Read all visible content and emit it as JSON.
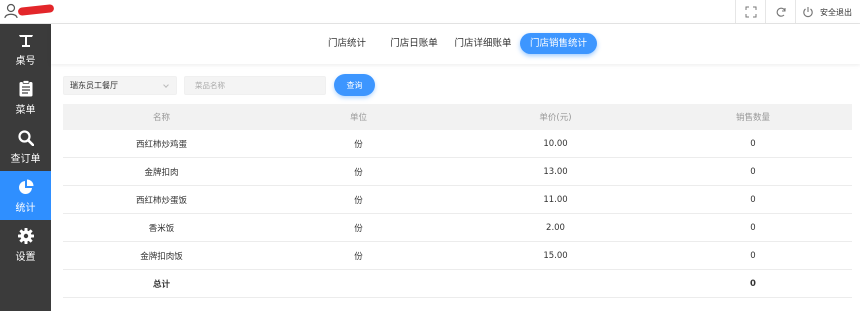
{
  "header": {
    "logout_label": "安全退出",
    "icons": [
      "user-icon",
      "fullscreen-icon",
      "refresh-icon",
      "power-icon"
    ]
  },
  "sidebar": {
    "items": [
      {
        "label": "桌号",
        "icon": "table-icon",
        "active": false
      },
      {
        "label": "菜单",
        "icon": "clipboard-icon",
        "active": false
      },
      {
        "label": "查订单",
        "icon": "search-icon",
        "active": false
      },
      {
        "label": "统计",
        "icon": "pie-chart-icon",
        "active": true
      },
      {
        "label": "设置",
        "icon": "gear-icon",
        "active": false
      }
    ]
  },
  "tabs": [
    {
      "label": "门店统计",
      "active": false
    },
    {
      "label": "门店日账单",
      "active": false
    },
    {
      "label": "门店详细账单",
      "active": false
    },
    {
      "label": "门店销售统计",
      "active": true
    }
  ],
  "filters": {
    "store_value": "瑞东员工餐厅",
    "dish_placeholder": "菜品名称",
    "query_label": "查询"
  },
  "table": {
    "columns": [
      "名称",
      "单位",
      "单价(元)",
      "销售数量"
    ],
    "rows": [
      [
        "西红柿炒鸡蛋",
        "份",
        "10.00",
        "0"
      ],
      [
        "金牌扣肉",
        "份",
        "13.00",
        "0"
      ],
      [
        "西红柿炒蛋饭",
        "份",
        "11.00",
        "0"
      ],
      [
        "香米饭",
        "份",
        "2.00",
        "0"
      ],
      [
        "金牌扣肉饭",
        "份",
        "15.00",
        "0"
      ]
    ],
    "total": {
      "label": "总计",
      "quantity": "0"
    }
  },
  "colors": {
    "accent": "#3d96ff",
    "sidebar": "#3b3b3b",
    "sidebar_active": "#2f8fff"
  }
}
